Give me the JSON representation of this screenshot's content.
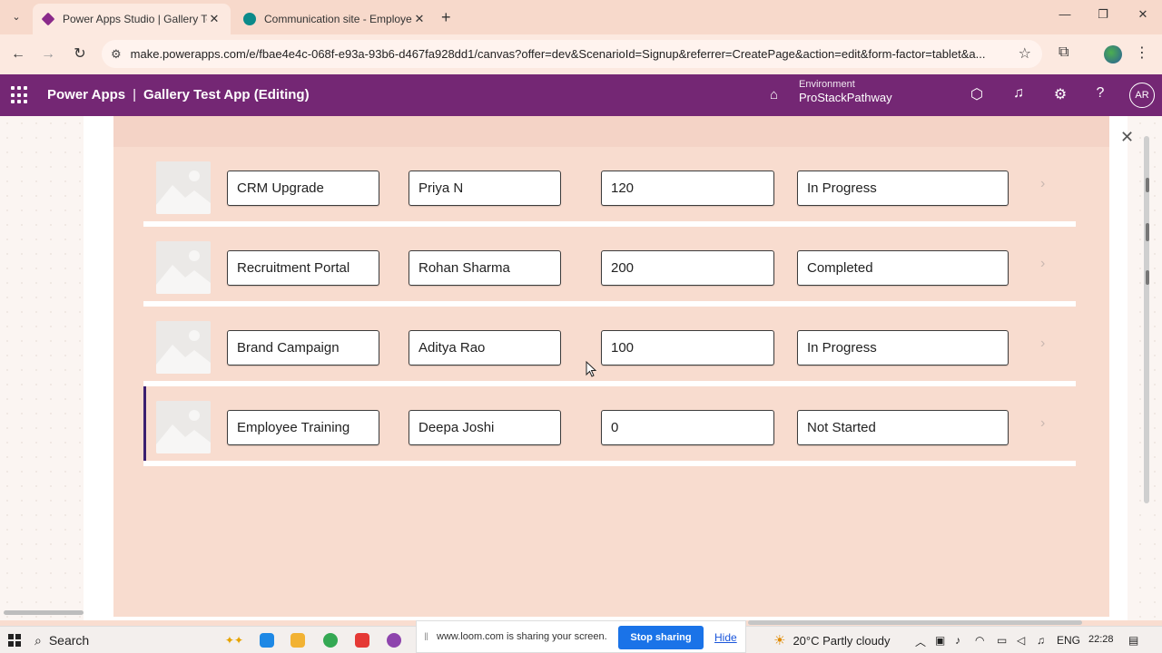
{
  "browser": {
    "tabs": [
      {
        "title": "Power Apps Studio | Gallery Te",
        "active": true
      },
      {
        "title": "Communication site - Employe",
        "active": false
      }
    ],
    "url": "make.powerapps.com/e/fbae4e4c-068f-e93a-93b6-d467fa928dd1/canvas?offer=dev&ScenarioId=Signup&referrer=CreatePage&action=edit&form-factor=tablet&a..."
  },
  "header": {
    "brand": "Power Apps",
    "separator": "|",
    "app_title": "Gallery Test App (Editing)",
    "environment_label": "Environment",
    "environment_name": "ProStackPathway",
    "user_initials": "AR"
  },
  "gallery": {
    "rows": [
      {
        "project": "CRM Upgrade",
        "owner": "Priya N",
        "value": "120",
        "status": "In Progress"
      },
      {
        "project": "Recruitment Portal",
        "owner": "Rohan Sharma",
        "value": "200",
        "status": "Completed"
      },
      {
        "project": "Brand Campaign",
        "owner": "Aditya Rao",
        "value": "100",
        "status": "In Progress"
      },
      {
        "project": "Employee Training",
        "owner": "Deepa Joshi",
        "value": "0",
        "status": "Not Started"
      }
    ],
    "selected_index": 3
  },
  "taskbar": {
    "search_label": "Search",
    "loom_message": "www.loom.com is sharing your screen.",
    "stop_sharing": "Stop sharing",
    "hide": "Hide",
    "weather": "20°C  Partly cloudy",
    "language": "ENG",
    "time": "22:28"
  },
  "colors": {
    "header_bg": "#742774",
    "app_surface": "#f8dccf",
    "selected_bar": "#3b1f70",
    "loom_button": "#1a73e8"
  }
}
